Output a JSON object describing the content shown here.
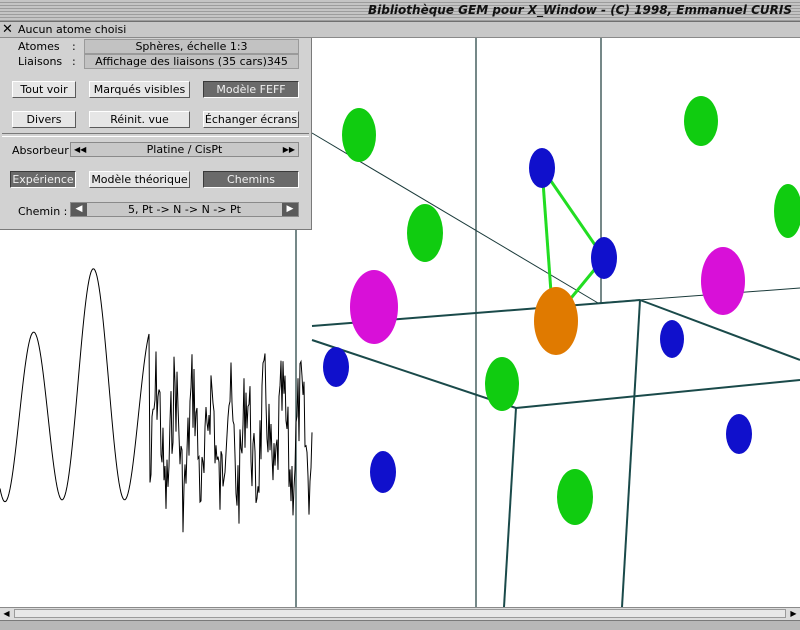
{
  "window": {
    "title": "Bibliothèque GEM pour X_Window - (C) 1998, Emmanuel CURIS"
  },
  "status": {
    "close_glyph": "✕",
    "text": "Aucun atome choisi"
  },
  "panel": {
    "atomes_label": "Atomes",
    "atomes_colon": ":",
    "atomes_value": "Sphères, échelle 1:3",
    "liaisons_label": "Liaisons",
    "liaisons_colon": ":",
    "liaisons_value": "Affichage des liaisons (35 cars)345",
    "btn_tout_voir": "Tout voir",
    "btn_marques_visibles": "Marqués visibles",
    "btn_modele_feff": "Modèle FEFF",
    "btn_divers": "Divers",
    "btn_reinit_vue": "Réinit. vue",
    "btn_echanger_ecrans": "Échanger écrans",
    "absorbeur_label": "Absorbeur",
    "absorbeur_value": "Platine / CisPt",
    "btn_experience": "Expérience",
    "btn_modele_theorique": "Modèle théorique",
    "btn_chemins": "Chemins",
    "chemin_label": "Chemin :",
    "chemin_value": "5, Pt -> N -> N -> Pt",
    "arrow_left": "◀",
    "arrow_right": "▶",
    "dbl_left": "◀◀",
    "dbl_right": "▶▶"
  },
  "scroll": {
    "left": "◀",
    "right": "▶"
  },
  "colors": {
    "nitrogen": "#1010cc",
    "carbon": "#10cc10",
    "chlorine": "#d810d8",
    "platinum": "#e07a00",
    "bond": "#22dd22",
    "box_edge": "#1a4a4a"
  },
  "atoms": [
    "blue-N",
    "green-C",
    "magenta-Cl",
    "orange-Pt"
  ]
}
